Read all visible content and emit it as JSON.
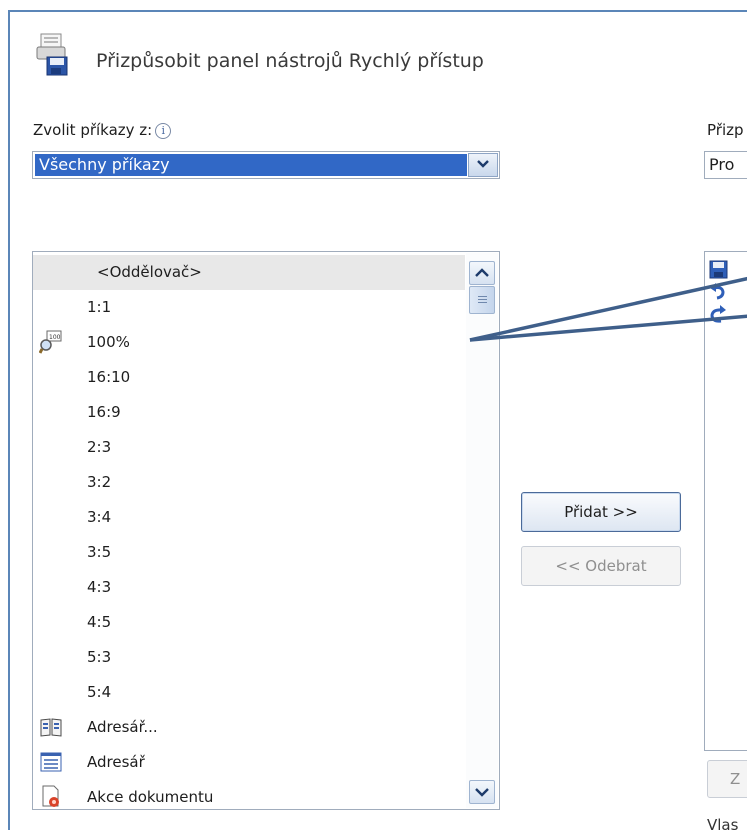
{
  "dialog": {
    "title": "Přizpůsobit panel nástrojů Rychlý přístup"
  },
  "choose_commands": {
    "label": "Zvolit příkazy z:",
    "info_symbol": "i",
    "selected_value": "Všechny příkazy"
  },
  "right_panel": {
    "label_partial": "Přizp",
    "combo_partial": "Pro",
    "button_partial": "Z",
    "footer_partial": "Vlas",
    "icons": [
      "save-icon",
      "undo-icon",
      "redo-icon"
    ]
  },
  "commands_list": [
    {
      "label": "<Oddělovač>",
      "icon": "",
      "selected": true
    },
    {
      "label": "1:1",
      "icon": ""
    },
    {
      "label": "100%",
      "icon": "zoom-100-icon"
    },
    {
      "label": "16:10",
      "icon": ""
    },
    {
      "label": "16:9",
      "icon": ""
    },
    {
      "label": "2:3",
      "icon": ""
    },
    {
      "label": "3:2",
      "icon": ""
    },
    {
      "label": "3:4",
      "icon": ""
    },
    {
      "label": "3:5",
      "icon": ""
    },
    {
      "label": "4:3",
      "icon": ""
    },
    {
      "label": "4:5",
      "icon": ""
    },
    {
      "label": "5:3",
      "icon": ""
    },
    {
      "label": "5:4",
      "icon": ""
    },
    {
      "label": "Adresář...",
      "icon": "address-book-icon"
    },
    {
      "label": "Adresář",
      "icon": "list-icon"
    },
    {
      "label": "Akce dokumentu",
      "icon": "document-actions-icon"
    }
  ],
  "buttons": {
    "add": "Přidat >>",
    "remove": "<< Odebrat"
  },
  "colors": {
    "selection": "#3168c6",
    "frame": "#5b86b8",
    "callout": "#3f5f8a"
  }
}
